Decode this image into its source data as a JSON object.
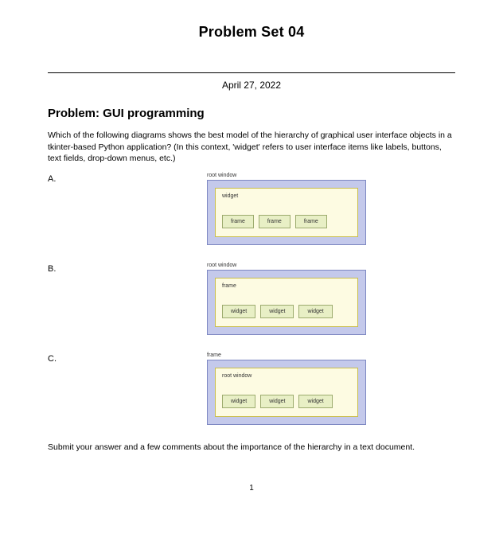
{
  "title": "Problem Set 04",
  "date": "April 27, 2022",
  "problem_heading": "Problem: GUI programming",
  "question_text": "Which of the following diagrams shows the best model of the hierarchy of graphical user interface objects in a tkinter-based Python application? (In this context, 'widget' refers to user interface items like labels, buttons, text fields, drop-down menus, etc.)",
  "options": {
    "a": {
      "letter": "A.",
      "outer_label": "root window",
      "mid_label": "widget",
      "inner1": "frame",
      "inner2": "frame",
      "inner3": "frame"
    },
    "b": {
      "letter": "B.",
      "outer_label": "root window",
      "mid_label": "frame",
      "inner1": "widget",
      "inner2": "widget",
      "inner3": "widget"
    },
    "c": {
      "letter": "C.",
      "outer_label": "frame",
      "mid_label": "root window",
      "inner1": "widget",
      "inner2": "widget",
      "inner3": "widget"
    }
  },
  "submit_text": "Submit your answer and a few comments about the importance of the hierarchy in a text document.",
  "page_number": "1"
}
